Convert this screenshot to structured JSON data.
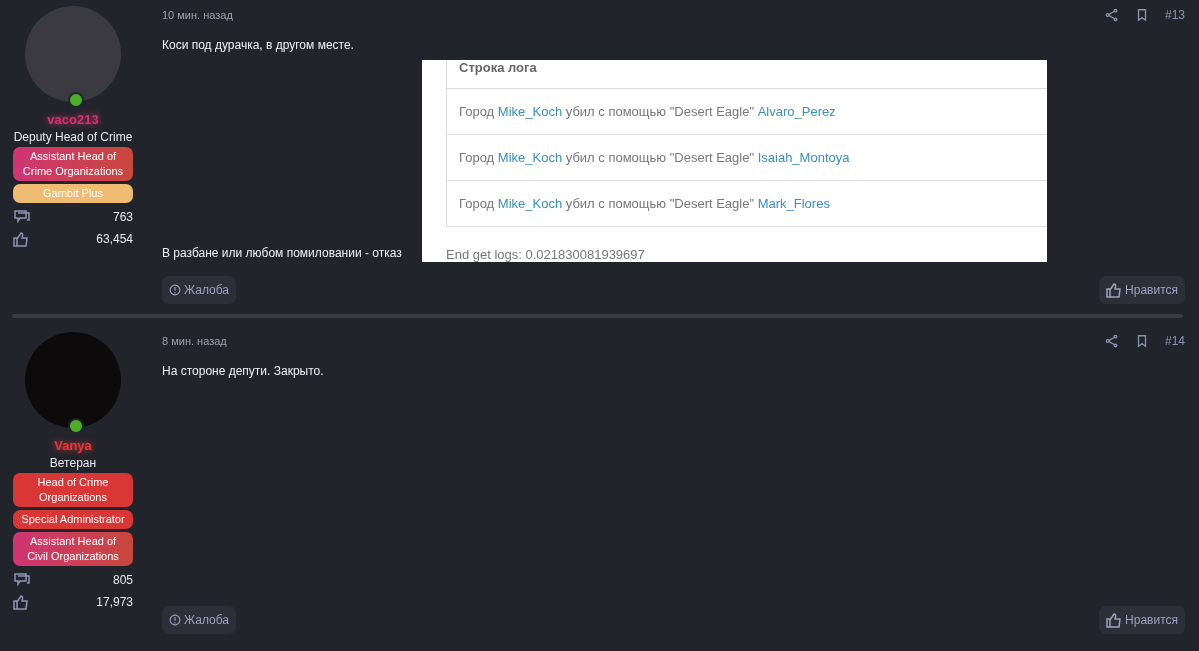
{
  "posts": [
    {
      "author": {
        "name": "vaco213",
        "color": "#d23468",
        "title": "Deputy Head of Crime",
        "badges": [
          {
            "label": "Assistant Head of Crime Organizations",
            "color": "#cf3574",
            "kind": "gradient"
          },
          {
            "label": "Gambit Plus",
            "color": "#f0bc72",
            "kind": "solid"
          }
        ],
        "messages": "763",
        "reactions": "63,454"
      },
      "time": "10 мин. назад",
      "number": "#13",
      "paragraphs": [
        "Коси под дурачка, в другом месте.",
        "В разбане или любом помиловании - отказ"
      ],
      "attachment": {
        "header": "Строка лога",
        "rows": [
          {
            "city": "Город",
            "killer": "Mike_Koch",
            "action": "убил с помощью \"Desert Eagle\"",
            "victim": "Alvaro_Perez"
          },
          {
            "city": "Город",
            "killer": "Mike_Koch",
            "action": "убил с помощью \"Desert Eagle\"",
            "victim": "Isaiah_Montoya"
          },
          {
            "city": "Город",
            "killer": "Mike_Koch",
            "action": "убил с помощью \"Desert Eagle\"",
            "victim": "Mark_Flores"
          }
        ],
        "footer": "End get logs: 0.021830081939697"
      },
      "report": "Жалоба",
      "like": "Нравится"
    },
    {
      "author": {
        "name": "Vanya",
        "color": "#e23a3a",
        "title": "Ветеран",
        "badges": [
          {
            "label": "Head of Crime Organizations",
            "color": "#d93636",
            "kind": "solid"
          },
          {
            "label": "Special Administrator",
            "color": "#d93636",
            "kind": "solid"
          },
          {
            "label": "Assistant Head of Civil Organizations",
            "color": "#cf3574",
            "kind": "gradient"
          }
        ],
        "messages": "805",
        "reactions": "17,973"
      },
      "time": "8 мин. назад",
      "number": "#14",
      "paragraphs": [
        "На стороне депути. Закрыто."
      ],
      "report": "Жалоба",
      "like": "Нравится"
    }
  ]
}
